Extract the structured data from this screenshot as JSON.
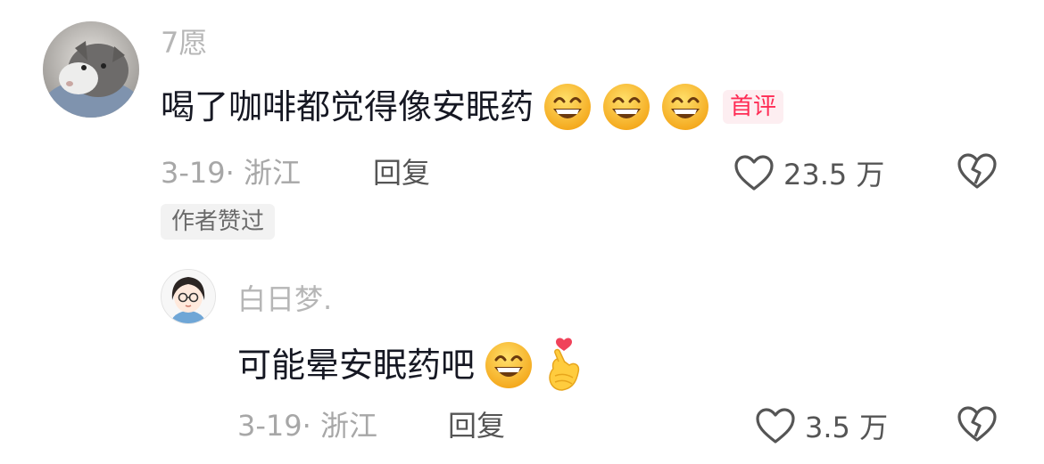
{
  "comment": {
    "username": "7愿",
    "text": "喝了咖啡都觉得像安眠药",
    "emojis": [
      "grin-emoji",
      "grin-emoji",
      "grin-emoji"
    ],
    "badge": "首评",
    "date": "3-19",
    "location": "浙江",
    "meta_separator": "·",
    "reply_label": "回复",
    "likes": "23.5 万",
    "author_liked": "作者赞过"
  },
  "reply": {
    "username": "白日梦.",
    "text": "可能晕安眠药吧",
    "emojis": [
      "grin-emoji",
      "finger-heart-emoji"
    ],
    "date": "3-19",
    "location": "浙江",
    "meta_separator": "·",
    "reply_label": "回复",
    "likes": "3.5 万"
  },
  "colors": {
    "text_primary": "#161823",
    "text_secondary": "#a7a7a7",
    "badge_red": "#fe2c55"
  }
}
